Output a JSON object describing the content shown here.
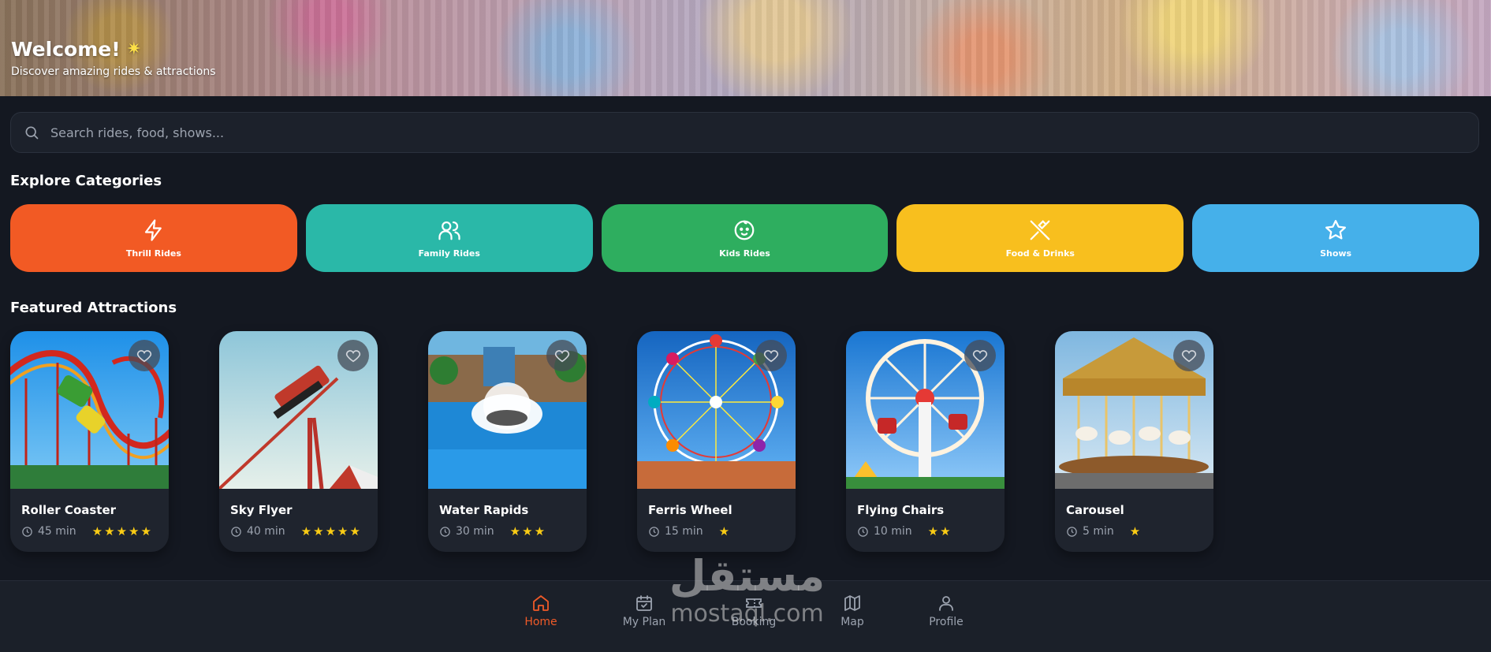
{
  "hero": {
    "title": "Welcome!",
    "subtitle": "Discover amazing rides & attractions"
  },
  "search": {
    "placeholder": "Search rides, food, shows..."
  },
  "sections": {
    "categories_title": "Explore Categories",
    "featured_title": "Featured Attractions"
  },
  "categories": [
    {
      "label": "Thrill Rides",
      "icon": "lightning-icon",
      "color": "#f25a24"
    },
    {
      "label": "Family Rides",
      "icon": "users-icon",
      "color": "#2ab8a8"
    },
    {
      "label": "Kids Rides",
      "icon": "baby-face-icon",
      "color": "#2eae5f"
    },
    {
      "label": "Food & Drinks",
      "icon": "utensils-icon",
      "color": "#f8bf1e"
    },
    {
      "label": "Shows",
      "icon": "star-icon",
      "color": "#45b0ea"
    }
  ],
  "attractions": [
    {
      "name": "Roller Coaster",
      "duration": "45 min",
      "rating": 5
    },
    {
      "name": "Sky Flyer",
      "duration": "40 min",
      "rating": 5
    },
    {
      "name": "Water Rapids",
      "duration": "30 min",
      "rating": 3
    },
    {
      "name": "Ferris Wheel",
      "duration": "15 min",
      "rating": 1
    },
    {
      "name": "Flying Chairs",
      "duration": "10 min",
      "rating": 2
    },
    {
      "name": "Carousel",
      "duration": "5 min",
      "rating": 1
    }
  ],
  "nav": [
    {
      "label": "Home",
      "icon": "home-icon",
      "active": true
    },
    {
      "label": "My Plan",
      "icon": "calendar-icon",
      "active": false
    },
    {
      "label": "Booking",
      "icon": "ticket-icon",
      "active": false
    },
    {
      "label": "Map",
      "icon": "map-icon",
      "active": false
    },
    {
      "label": "Profile",
      "icon": "user-icon",
      "active": false
    }
  ],
  "watermark": {
    "arabic": "مستقل",
    "latin": "mostaql.com"
  },
  "colors": {
    "background": "#141821",
    "accent": "#f05a28",
    "star": "#facc15"
  }
}
